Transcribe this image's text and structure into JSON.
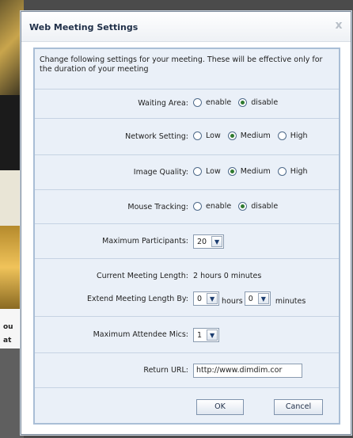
{
  "dialog": {
    "title": "Web Meeting Settings",
    "close_glyph": "x",
    "description": "Change following settings for your meeting. These will be effective only for the duration of your meeting"
  },
  "waiting_area": {
    "label": "Waiting Area:",
    "options": [
      "enable",
      "disable"
    ],
    "selected": "disable"
  },
  "network_setting": {
    "label": "Network Setting:",
    "options": [
      "Low",
      "Medium",
      "High"
    ],
    "selected": "Medium"
  },
  "image_quality": {
    "label": "Image Quality:",
    "options": [
      "Low",
      "Medium",
      "High"
    ],
    "selected": "Medium"
  },
  "mouse_tracking": {
    "label": "Mouse Tracking:",
    "options": [
      "enable",
      "disable"
    ],
    "selected": "disable"
  },
  "max_participants": {
    "label": "Maximum Participants:",
    "value": "20"
  },
  "meeting_length": {
    "current_label": "Current Meeting Length:",
    "current_value": "2 hours 0 minutes",
    "extend_label": "Extend Meeting Length By:",
    "hours_value": "0",
    "hours_unit": "hours",
    "minutes_value": "0",
    "minutes_unit": "minutes"
  },
  "max_mics": {
    "label": "Maximum Attendee Mics:",
    "value": "1"
  },
  "return_url": {
    "label": "Return URL:",
    "value": "http://www.dimdim.cor"
  },
  "buttons": {
    "ok": "OK",
    "cancel": "Cancel"
  },
  "colors": {
    "panel_bg": "#eaf0f8",
    "panel_border": "#a9bed6",
    "title_text": "#1f2f48",
    "radio_selected": "#2f7a2f"
  },
  "icons": {
    "close": "close-icon",
    "dropdown": "chevron-down-icon"
  },
  "background": {
    "fragment1": "ou",
    "fragment2": "at"
  }
}
